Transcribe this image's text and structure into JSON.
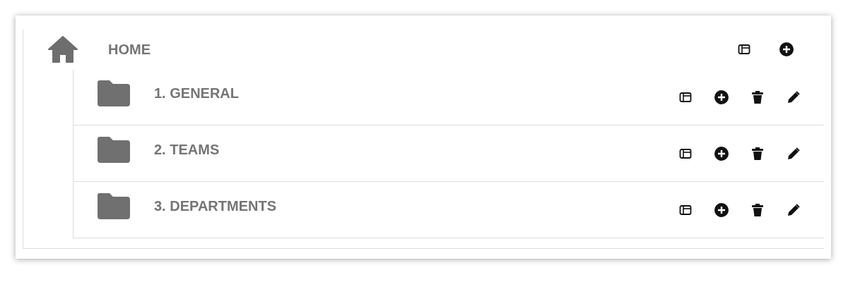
{
  "tree": {
    "label": "HOME",
    "actions": [
      {
        "kind": "panel"
      },
      {
        "kind": "add"
      }
    ],
    "children": [
      {
        "label": "1. GENERAL",
        "actions": [
          {
            "kind": "panel"
          },
          {
            "kind": "add"
          },
          {
            "kind": "delete"
          },
          {
            "kind": "edit"
          }
        ]
      },
      {
        "label": "2. TEAMS",
        "actions": [
          {
            "kind": "panel"
          },
          {
            "kind": "add"
          },
          {
            "kind": "delete"
          },
          {
            "kind": "edit"
          }
        ]
      },
      {
        "label": "3. DEPARTMENTS",
        "actions": [
          {
            "kind": "panel"
          },
          {
            "kind": "add"
          },
          {
            "kind": "delete"
          },
          {
            "kind": "edit"
          }
        ]
      }
    ]
  }
}
